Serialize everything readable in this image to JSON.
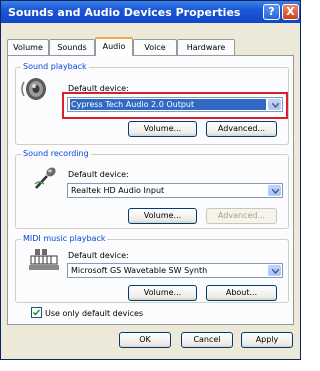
{
  "window": {
    "title": "Sounds and Audio Devices Properties",
    "help_glyph": "?",
    "close_glyph": "X"
  },
  "tabs": [
    "Volume",
    "Sounds",
    "Audio",
    "Voice",
    "Hardware"
  ],
  "active_tab": "Audio",
  "sound_playback": {
    "group_label": "Sound playback",
    "default_device_label": "Default device:",
    "device": "Cypress Tech Audio 2.0 Output",
    "volume_button": "Volume...",
    "advanced_button": "Advanced..."
  },
  "sound_recording": {
    "group_label": "Sound recording",
    "default_device_label": "Default device:",
    "device": "Realtek HD Audio Input",
    "volume_button": "Volume...",
    "advanced_button": "Advanced..."
  },
  "midi_playback": {
    "group_label": "MIDI music playback",
    "default_device_label": "Default device:",
    "device": "Microsoft GS Wavetable SW Synth",
    "volume_button": "Volume...",
    "about_button": "About..."
  },
  "use_only_default": {
    "label": "Use only default devices",
    "checked": true
  },
  "footer": {
    "ok": "OK",
    "cancel": "Cancel",
    "apply": "Apply"
  },
  "colors": {
    "title_bar": "#1a57d6",
    "group_label": "#0046d5",
    "highlight": "#d9202a",
    "selection": "#316ac5"
  }
}
